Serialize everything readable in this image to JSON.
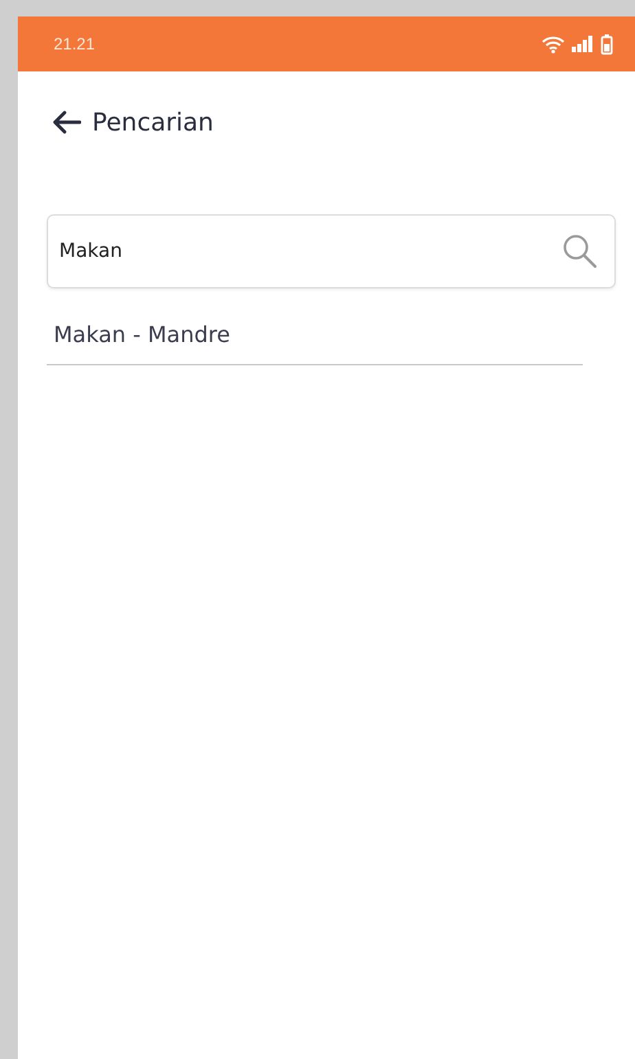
{
  "status_bar": {
    "time": "21.21"
  },
  "header": {
    "title": "Pencarian"
  },
  "search": {
    "value": "Makan"
  },
  "results": [
    {
      "label": "Makan - Mandre"
    }
  ]
}
